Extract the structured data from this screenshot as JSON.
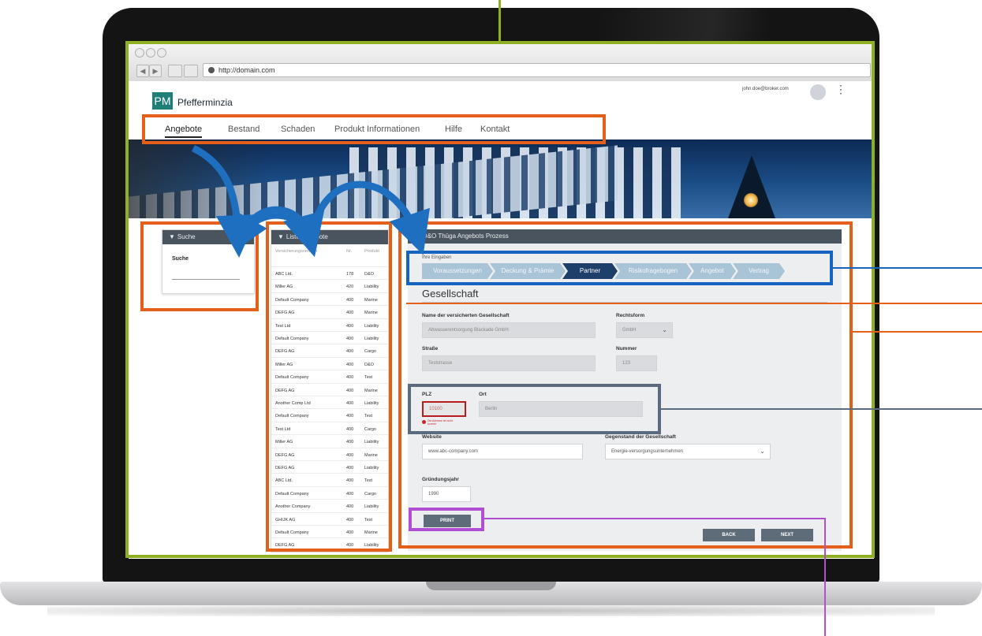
{
  "browser": {
    "back": "◀",
    "forward": "▶",
    "url": "http://domain.com"
  },
  "app": {
    "logo": "PM",
    "name": "Pfefferminzia",
    "user_email": "john.doe@broker.com",
    "menu_icon": "⋮"
  },
  "nav": [
    {
      "label": "Angebote",
      "active": true
    },
    {
      "label": "Bestand"
    },
    {
      "label": "Schaden"
    },
    {
      "label": "Produkt Informationen"
    },
    {
      "label": "Hilfe"
    },
    {
      "label": "Kontakt"
    }
  ],
  "search_panel": {
    "title": "Suche",
    "label": "Suche"
  },
  "list_panel": {
    "title": "Liste Angebote",
    "columns": [
      "Versicherungsnehmer",
      "Nr.",
      "Produkt"
    ],
    "rows": [
      [
        "ABC Ltd.",
        "178",
        "D&O"
      ],
      [
        "Miller AG",
        "420",
        "Liability"
      ],
      [
        "Default Company",
        "400",
        "Marine"
      ],
      [
        "DEFG AG",
        "400",
        "Marine"
      ],
      [
        "Test Ltd",
        "400",
        "Liability"
      ],
      [
        "Default Company",
        "400",
        "Liability"
      ],
      [
        "DEFG AG",
        "400",
        "Cargo"
      ],
      [
        "Miller AG",
        "400",
        "D&O"
      ],
      [
        "Default Company",
        "400",
        "Test"
      ],
      [
        "DEFG AG",
        "400",
        "Marine"
      ],
      [
        "Another Comp Ltd",
        "400",
        "Liability"
      ],
      [
        "Default Company",
        "400",
        "Test"
      ],
      [
        "Test Ltd",
        "400",
        "Cargo"
      ],
      [
        "Miller AG",
        "400",
        "Liability"
      ],
      [
        "DEFG AG",
        "400",
        "Marine"
      ],
      [
        "DEFG AG",
        "400",
        "Liability"
      ],
      [
        "ABC Ltd.",
        "400",
        "Test"
      ],
      [
        "Default Company",
        "400",
        "Cargo"
      ],
      [
        "Another Company",
        "400",
        "Liability"
      ],
      [
        "GHIJK AG",
        "400",
        "Test"
      ],
      [
        "Default Company",
        "400",
        "Marine"
      ],
      [
        "DEFG AG",
        "400",
        "Liability"
      ]
    ]
  },
  "process": {
    "title": "D&O Thüga Angebots Prozess",
    "breadcrumb_label": "Ihre Eingaben",
    "steps": [
      "Voraussetzungen",
      "Deckung & Prämie",
      "Partner",
      "Risikofragebogen",
      "Angebot",
      "Vertrag"
    ],
    "active_step": "Partner",
    "section": "Gesellschaft",
    "fields": {
      "name_label": "Name der versicherten Gesellschaft",
      "name_value": "Abwasserentsorgung Blackade GmbH",
      "rechtsform_label": "Rechtsform",
      "rechtsform_value": "GmbH",
      "strasse_label": "Straße",
      "strasse_value": "Teststrasse",
      "nummer_label": "Nummer",
      "nummer_value": "123",
      "plz_label": "PLZ",
      "plz_value": "10100",
      "plz_error": "Die Adresse ist nicht korrekt",
      "ort_label": "Ort",
      "ort_value": "Berlin",
      "website_label": "Website",
      "website_value": "www.abc-company.com",
      "gegenstand_label": "Gegenstand der Gesellschaft",
      "gegenstand_value": "Energie-versorgungsunternehmen",
      "gruendung_label": "Gründungsjahr",
      "gruendung_value": "1990"
    },
    "buttons": {
      "print": "PRINT",
      "back": "BACK",
      "next": "NEXT"
    }
  },
  "colors": {
    "frame_green": "#8db122",
    "annotation_orange": "#e4601a",
    "annotation_blue": "#1565c0",
    "annotation_slate": "#5a6b80",
    "annotation_purple": "#b04fd1",
    "arrow_blue": "#1e6fbf",
    "step_active": "#1d3f6a",
    "logo_teal": "#1e7f78"
  }
}
